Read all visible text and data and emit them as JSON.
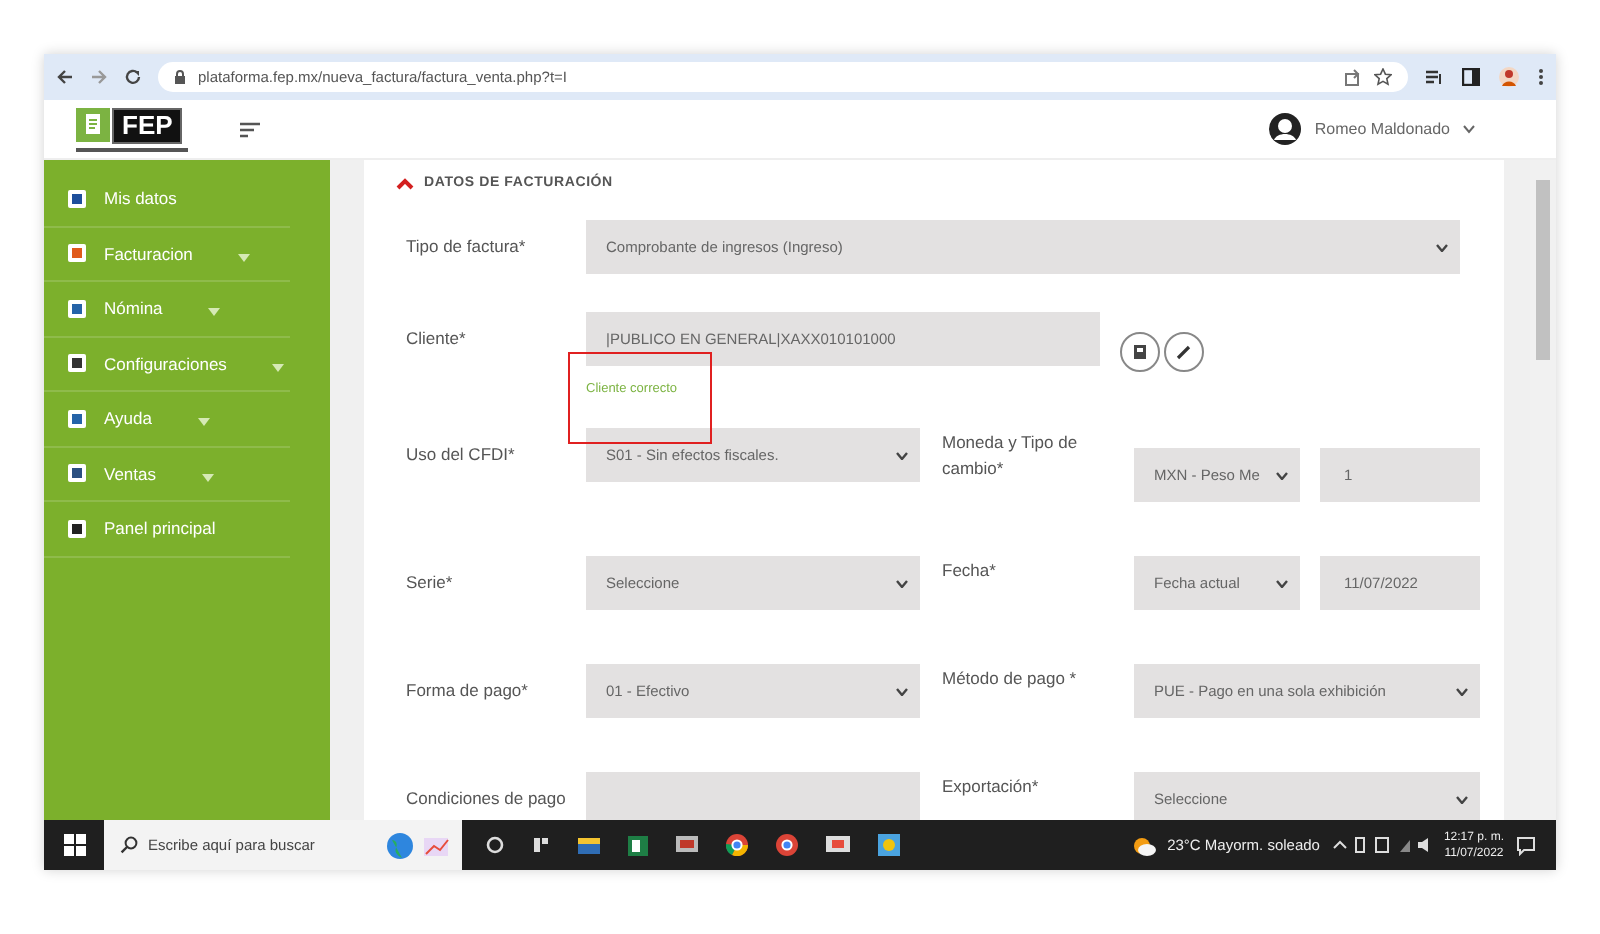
{
  "browser": {
    "url": "plataforma.fep.mx/nueva_factura/factura_venta.php?t=I"
  },
  "logo": {
    "text": "FEP"
  },
  "header": {
    "user": "Romeo Maldonado"
  },
  "sidebar": {
    "items": [
      {
        "label": "Mis datos",
        "submenu": false
      },
      {
        "label": "Facturacion",
        "submenu": true
      },
      {
        "label": "Nómina",
        "submenu": true
      },
      {
        "label": "Configuraciones",
        "submenu": true
      },
      {
        "label": "Ayuda",
        "submenu": true
      },
      {
        "label": "Ventas",
        "submenu": true
      },
      {
        "label": "Panel principal",
        "submenu": false
      }
    ]
  },
  "section": {
    "title": "DATOS DE FACTURACIÓN",
    "expanded": true
  },
  "form": {
    "rows": [
      {
        "fields": [
          {
            "label": "Tipo de factura*",
            "controls": [
              {
                "kind": "select-wide",
                "value": "Comprobante de ingresos (Ingreso)"
              }
            ]
          }
        ]
      },
      {
        "fields": [
          {
            "label": "Cliente*",
            "hint": "Cliente correcto",
            "controls": [
              {
                "kind": "text-wide",
                "value": "|PUBLICO EN GENERAL|XAXX010101000"
              },
              {
                "kind": "button-pair"
              }
            ]
          }
        ]
      },
      {
        "fields": [
          {
            "label": "Uso del CFDI*",
            "controls": [
              {
                "kind": "select",
                "value": "S01 - Sin efectos fiscales."
              }
            ]
          },
          {
            "label": "Moneda y Tipo de cambio*",
            "controls": [
              {
                "kind": "select-small",
                "value": "MXN - Peso Me"
              },
              {
                "kind": "text-small",
                "value": "1"
              }
            ]
          }
        ]
      },
      {
        "fields": [
          {
            "label": "Serie*",
            "controls": [
              {
                "kind": "select",
                "value": "Seleccione"
              }
            ]
          },
          {
            "label": "Fecha*",
            "controls": [
              {
                "kind": "select-small",
                "value": "Fecha actual"
              },
              {
                "kind": "text-small",
                "value": "11/07/2022"
              }
            ]
          }
        ]
      },
      {
        "fields": [
          {
            "label": "Forma de pago*",
            "controls": [
              {
                "kind": "select",
                "value": "01 - Efectivo"
              }
            ]
          },
          {
            "label": "Método de pago *",
            "controls": [
              {
                "kind": "select-right",
                "value": "PUE - Pago en una sola exhibición"
              }
            ]
          }
        ]
      },
      {
        "fields": [
          {
            "label": "Condiciones de pago",
            "controls": [
              {
                "kind": "text"
              }
            ]
          },
          {
            "label": "Exportación*",
            "controls": [
              {
                "kind": "select-right",
                "value": "Seleccione"
              }
            ]
          }
        ]
      }
    ]
  },
  "taskbar": {
    "search_placeholder": "Escribe aquí para buscar",
    "weather": "23°C  Mayorm. soleado",
    "time": "12:17 p. m.",
    "date": "11/07/2022"
  }
}
